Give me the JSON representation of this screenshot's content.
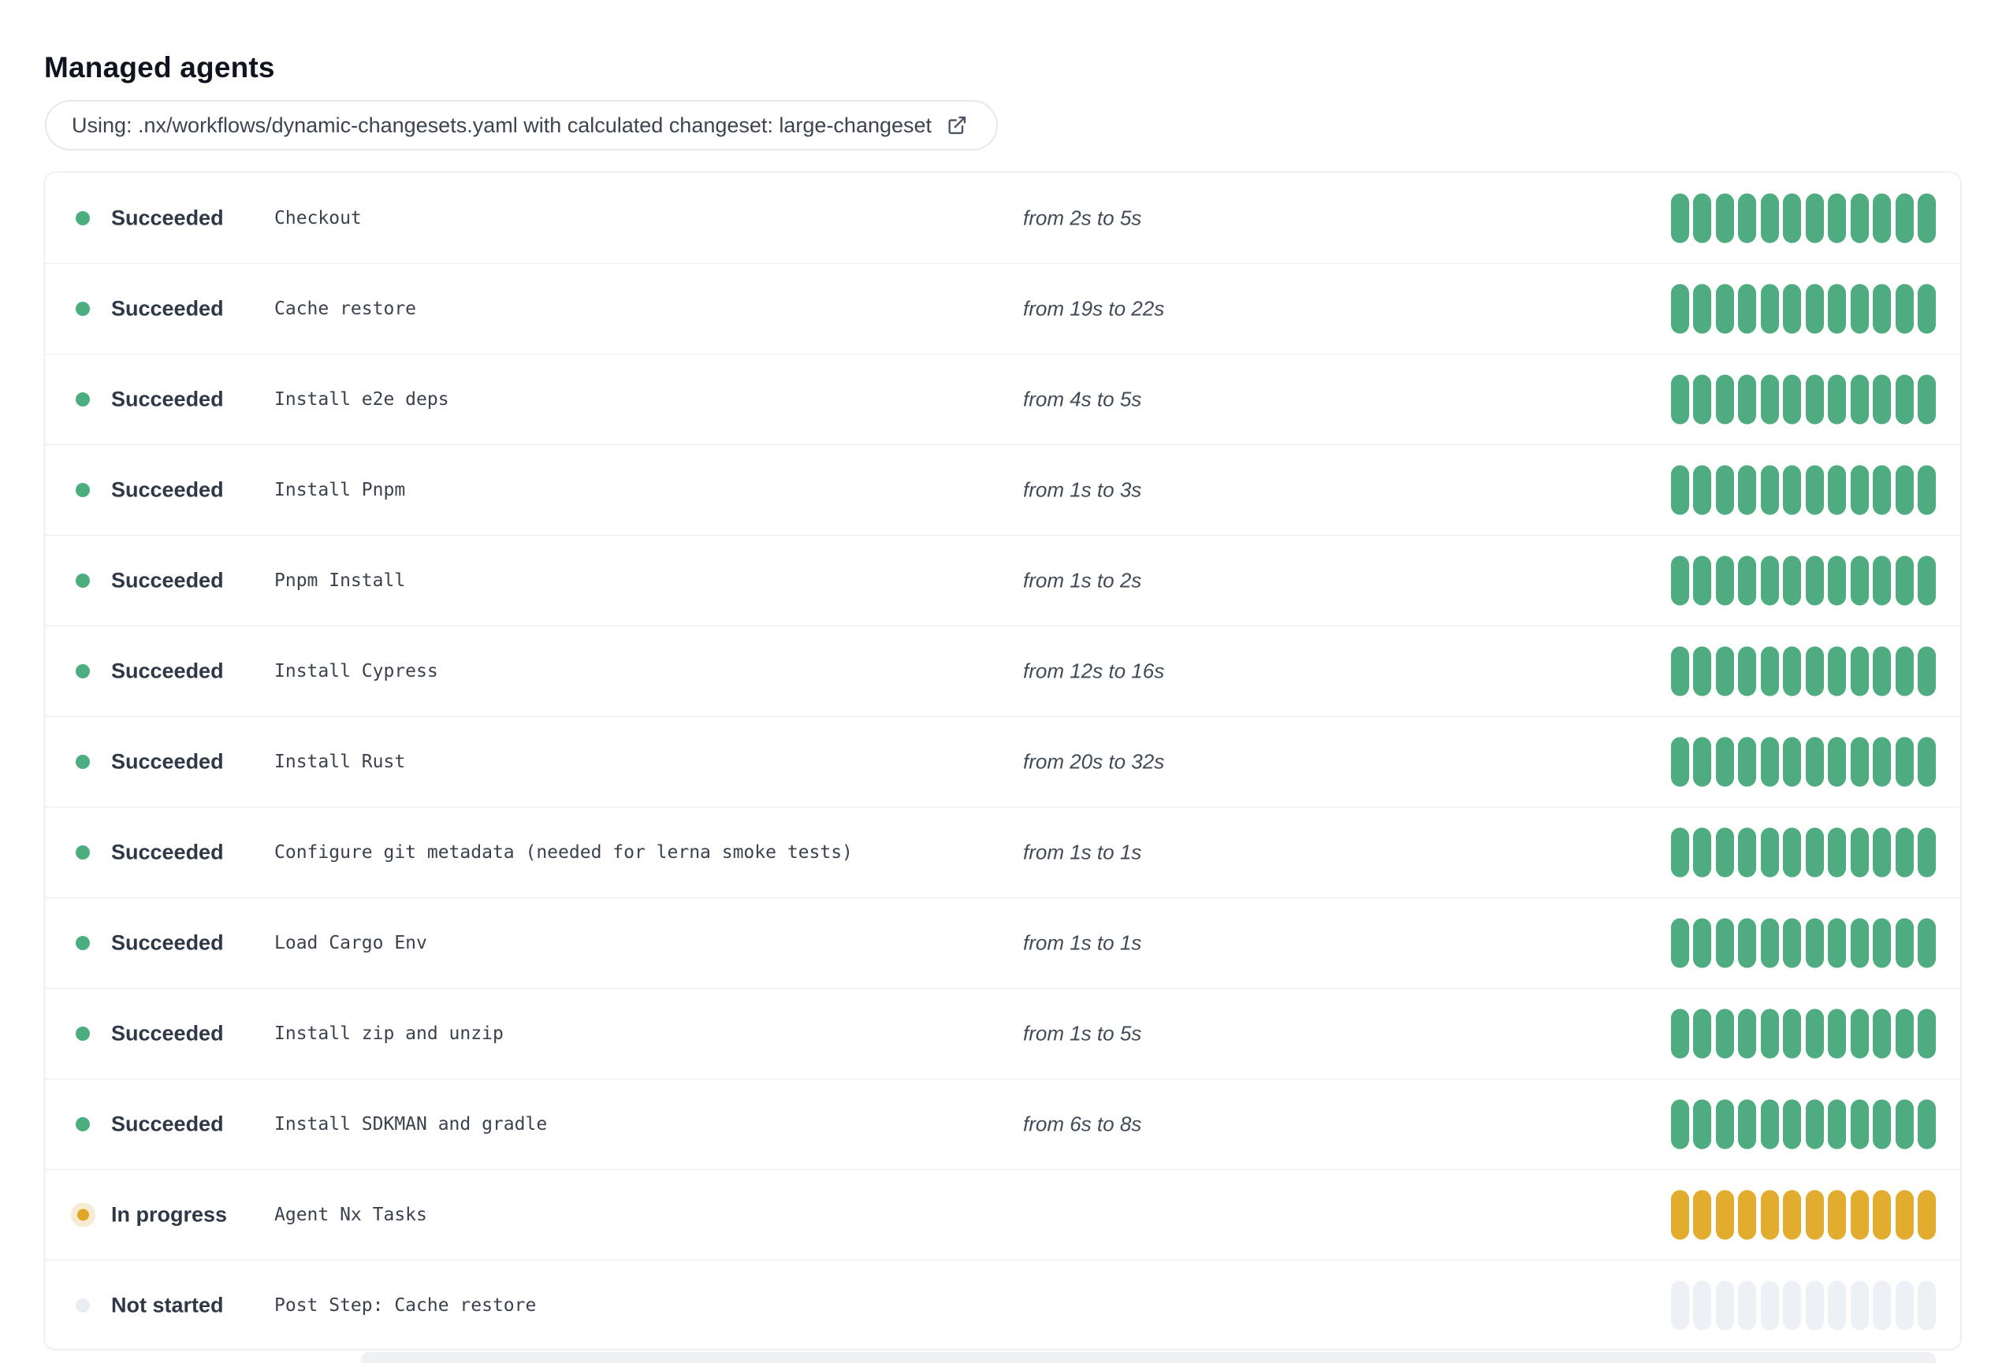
{
  "page": {
    "title": "Managed agents"
  },
  "workflow_banner": {
    "text": "Using: .nx/workflows/dynamic-changesets.yaml with calculated changeset: large-changeset",
    "icon": "external-link-icon"
  },
  "colors": {
    "succeeded_dot": "#4cae80",
    "succeeded_bar": "#4fab80",
    "in_progress_dot": "#dfa927",
    "in_progress_halo": "#f5ecd1",
    "in_progress_bar": "#e2ad2f",
    "not_started_dot": "#e9eef4",
    "not_started_bar": "#edf1f6",
    "card_border": "#e6e8eb",
    "row_divider": "#e9ebee"
  },
  "agents": {
    "bar_count": 12,
    "status_labels": {
      "succeeded": "Succeeded",
      "in_progress": "In progress",
      "not_started": "Not started"
    },
    "rows": [
      {
        "status": "succeeded",
        "name": "Checkout",
        "duration": "from 2s to 5s"
      },
      {
        "status": "succeeded",
        "name": "Cache restore",
        "duration": "from 19s to 22s"
      },
      {
        "status": "succeeded",
        "name": "Install e2e deps",
        "duration": "from 4s to 5s"
      },
      {
        "status": "succeeded",
        "name": "Install Pnpm",
        "duration": "from 1s to 3s"
      },
      {
        "status": "succeeded",
        "name": "Pnpm Install",
        "duration": "from 1s to 2s"
      },
      {
        "status": "succeeded",
        "name": "Install Cypress",
        "duration": "from 12s to 16s"
      },
      {
        "status": "succeeded",
        "name": "Install Rust",
        "duration": "from 20s to 32s"
      },
      {
        "status": "succeeded",
        "name": "Configure git metadata (needed for lerna smoke tests)",
        "duration": "from 1s to 1s"
      },
      {
        "status": "succeeded",
        "name": "Load Cargo Env",
        "duration": "from 1s to 1s"
      },
      {
        "status": "succeeded",
        "name": "Install zip and unzip",
        "duration": "from 1s to 5s"
      },
      {
        "status": "succeeded",
        "name": "Install SDKMAN and gradle",
        "duration": "from 6s to 8s"
      },
      {
        "status": "in_progress",
        "name": "Agent Nx Tasks",
        "duration": ""
      },
      {
        "status": "not_started",
        "name": "Post Step: Cache restore",
        "duration": ""
      }
    ]
  }
}
